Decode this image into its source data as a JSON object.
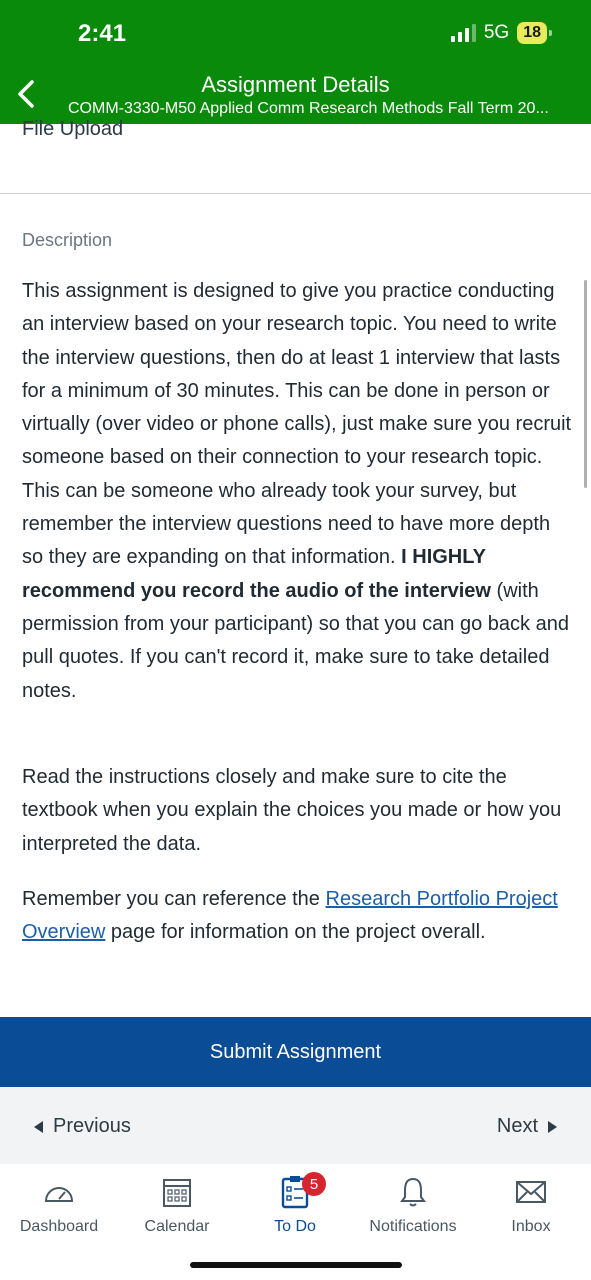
{
  "status": {
    "time": "2:41",
    "network": "5G",
    "battery": "18"
  },
  "header": {
    "title": "Assignment Details",
    "subtitle": "COMM-3330-M50 Applied Comm Research Methods Fall Term 20..."
  },
  "submission_type": "File Upload",
  "description": {
    "label": "Description",
    "p1_text": "This assignment is designed to give you practice conducting an interview based on your research topic. You need to write the interview questions, then do at least 1 interview that lasts for a minimum of 30 minutes. This can be done in person or virtually (over video or phone calls), just make sure you recruit someone based on their connection to your research topic. This can be someone who already took your survey, but remember the interview questions need to have more depth so they are expanding on that information. ",
    "p1_bold": "I HIGHLY recommend you record the audio of the interview",
    "p1_tail": " (with permission from your participant) so that you can go back and pull quotes. If you can't record it, make sure to take detailed notes.",
    "p2": "Read the instructions closely and make sure to cite the textbook when you explain the choices you made or how you interpreted the data.",
    "p3_pre": "Remember you can reference the ",
    "p3_link": "Research Portfolio Project Overview",
    "p3_post": " page for information on the project overall."
  },
  "submit_label": "Submit Assignment",
  "pager": {
    "previous": "Previous",
    "next": "Next"
  },
  "tabs": [
    {
      "label": "Dashboard",
      "icon": "dashboard-icon"
    },
    {
      "label": "Calendar",
      "icon": "calendar-icon"
    },
    {
      "label": "To Do",
      "icon": "todo-icon",
      "badge": "5"
    },
    {
      "label": "Notifications",
      "icon": "bell-icon"
    },
    {
      "label": "Inbox",
      "icon": "mail-icon"
    }
  ],
  "colors": {
    "header": "#0a8a0a",
    "submit": "#0a4c96",
    "link": "#1c5fa8",
    "badge": "#d6252f"
  }
}
